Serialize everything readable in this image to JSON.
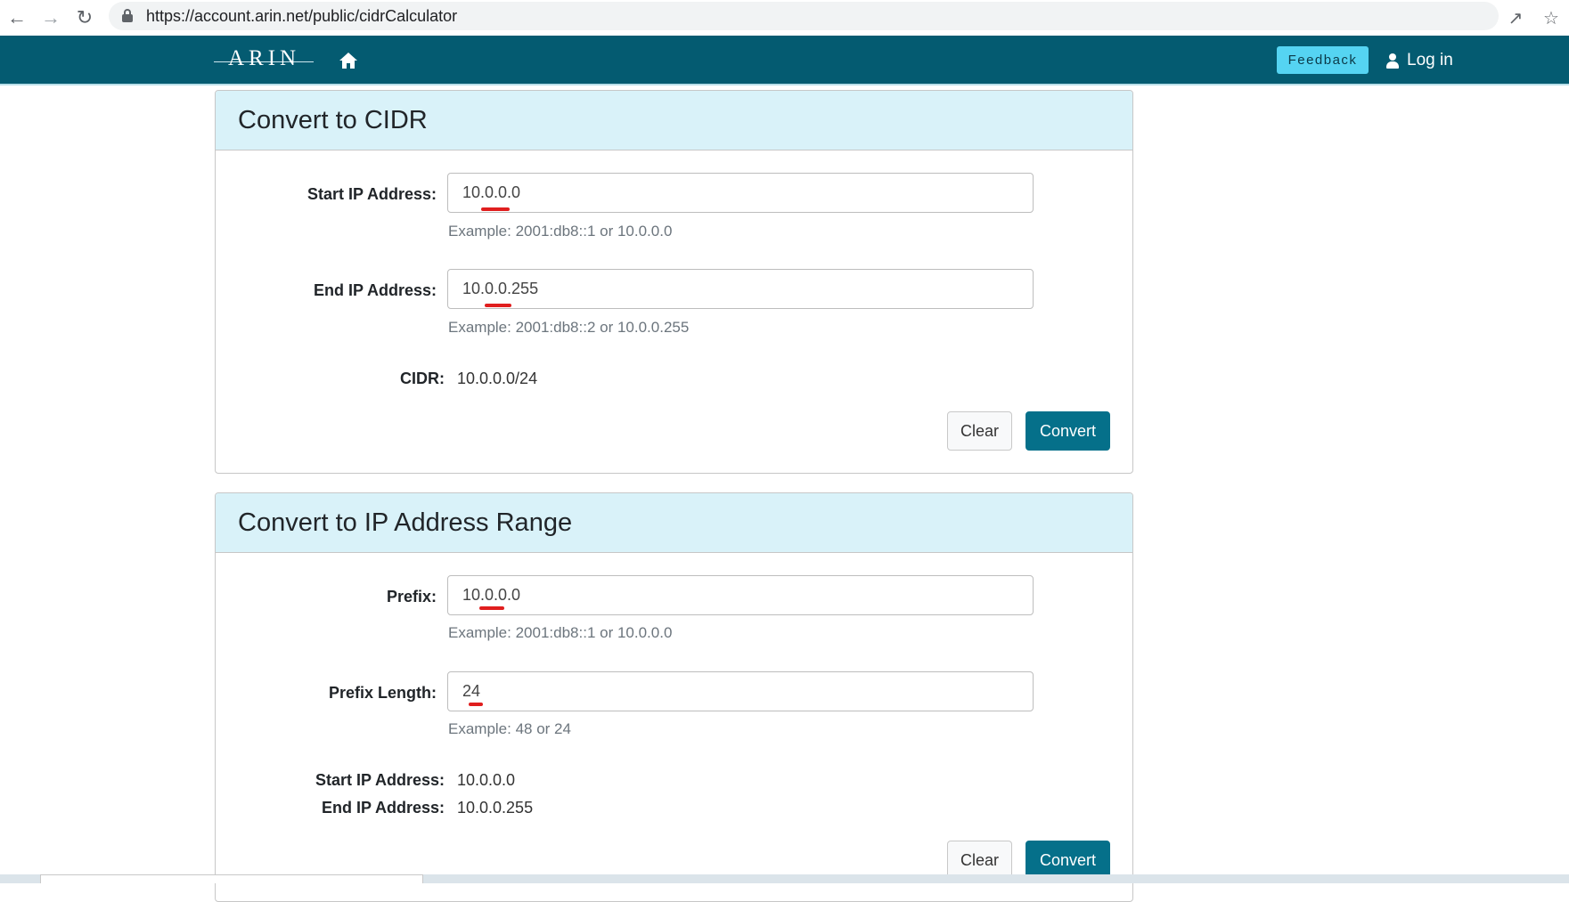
{
  "browser": {
    "url": "https://account.arin.net/public/cidrCalculator"
  },
  "header": {
    "logo": "ARIN",
    "feedback_label": "Feedback",
    "login_label": "Log in"
  },
  "cidr_card": {
    "title": "Convert to CIDR",
    "start_label": "Start IP Address:",
    "start_value": "10.0.0.0",
    "start_example": "Example: 2001:db8::1 or 10.0.0.0",
    "end_label": "End IP Address:",
    "end_value": "10.0.0.255",
    "end_example": "Example: 2001:db8::2 or 10.0.0.255",
    "result_label": "CIDR:",
    "result_value": "10.0.0.0/24",
    "clear_label": "Clear",
    "convert_label": "Convert"
  },
  "range_card": {
    "title": "Convert to IP Address Range",
    "prefix_label": "Prefix:",
    "prefix_value": "10.0.0.0",
    "prefix_example": "Example: 2001:db8::1 or 10.0.0.0",
    "length_label": "Prefix Length:",
    "length_value": "24",
    "length_example": "Example: 48 or 24",
    "start_result_label": "Start IP Address:",
    "start_result_value": "10.0.0.0",
    "end_result_label": "End IP Address:",
    "end_result_value": "10.0.0.255",
    "clear_label": "Clear",
    "convert_label": "Convert"
  },
  "colors": {
    "header_bg": "#045b71",
    "card_header_bg": "#d9f2f9",
    "convert_bg": "#05708a",
    "feedback_bg": "#55d4f2",
    "annotation_red": "#e01e1e"
  }
}
